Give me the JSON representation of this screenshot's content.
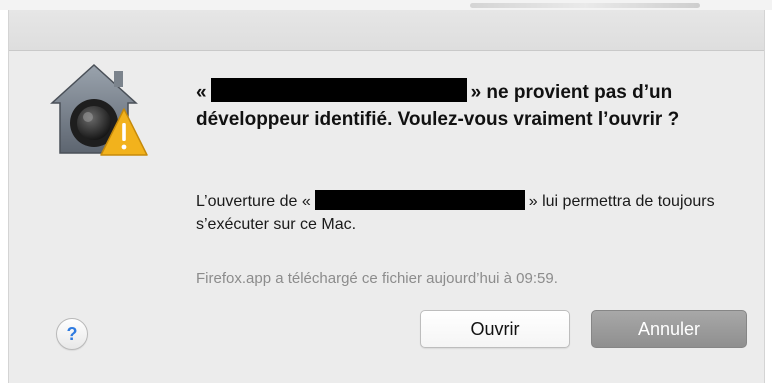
{
  "dialog": {
    "title_prefix": "«",
    "title_rest": "» ne provient pas d’un développeur identifié. Voulez-vous vraiment l’ouvrir ?",
    "info_prefix": "L’ouverture de «",
    "info_rest": "» lui permettra de toujours s’exécuter sur ce Mac.",
    "note": "Firefox.app a téléchargé ce fichier aujourd’hui à 09:59.",
    "help_label": "?",
    "open_label": "Ouvrir",
    "cancel_label": "Annuler"
  },
  "icons": {
    "app": "gatekeeper-house-icon",
    "warning": "warning-triangle-icon",
    "help": "help-icon"
  },
  "colors": {
    "cancel_button": "#999999",
    "help_accent": "#2f7be0",
    "warning": "#f2b21c"
  }
}
